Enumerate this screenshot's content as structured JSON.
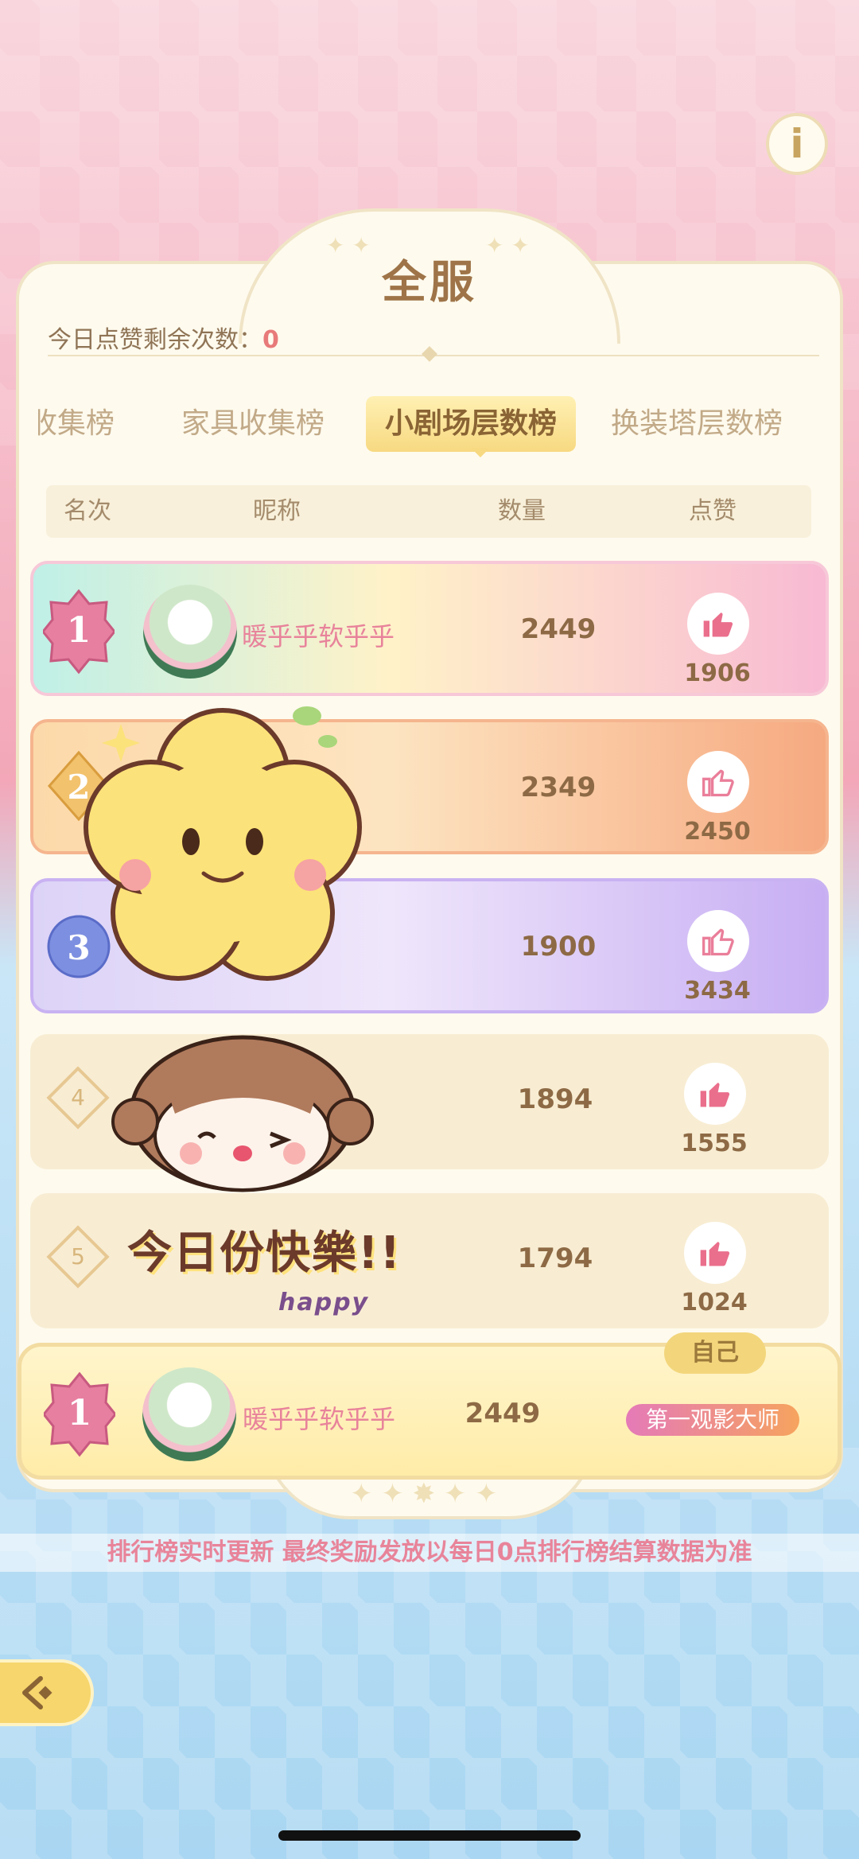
{
  "header": {
    "title": "全服"
  },
  "likes_remaining": {
    "label": "今日点赞剩余次数：",
    "value": "0"
  },
  "tabs": [
    {
      "label": "收集榜",
      "active": false
    },
    {
      "label": "家具收集榜",
      "active": false
    },
    {
      "label": "小剧场层数榜",
      "active": true
    },
    {
      "label": "换装塔层数榜",
      "active": false
    }
  ],
  "columns": {
    "rank": "名次",
    "nickname": "昵称",
    "quantity": "数量",
    "likes": "点赞"
  },
  "rows": [
    {
      "rank": "1",
      "nickname": "暖乎乎软乎乎",
      "quantity": "2449",
      "likes": "1906"
    },
    {
      "rank": "2",
      "nickname": "",
      "quantity": "2349",
      "likes": "2450"
    },
    {
      "rank": "3",
      "nickname": "",
      "quantity": "1900",
      "likes": "3434"
    },
    {
      "rank": "4",
      "nickname": "",
      "quantity": "1894",
      "likes": "1555"
    },
    {
      "rank": "5",
      "nickname": "",
      "quantity": "1794",
      "likes": "1024"
    }
  ],
  "self_row": {
    "tag": "自己",
    "rank": "1",
    "nickname": "暖乎乎软乎乎",
    "quantity": "2449",
    "title_badge": "第一观影大师"
  },
  "notice": "排行榜实时更新 最终奖励发放以每日0点排行榜结算数据为准",
  "stickers": {
    "text_main": "今日份快樂!!",
    "text_sub": "happy"
  },
  "icons": {
    "info": "info-icon",
    "like": "thumbs-up-icon",
    "back": "back-arrow-icon"
  },
  "colors": {
    "accent_pink": "#e8839b",
    "gold": "#f6d66d",
    "brown": "#8d6a45"
  }
}
